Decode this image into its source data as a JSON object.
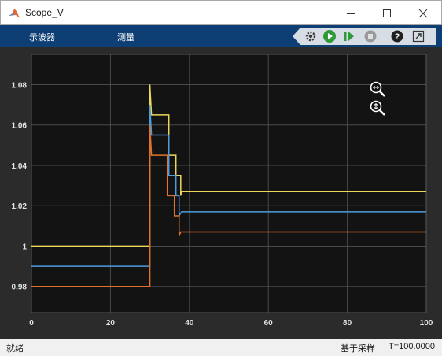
{
  "window": {
    "title": "Scope_V"
  },
  "toolbar": {
    "menu_view": "示波器",
    "menu_measure": "测量",
    "buttons": [
      {
        "icon": "gear-icon"
      },
      {
        "icon": "run-icon"
      },
      {
        "icon": "step-forward-icon"
      },
      {
        "icon": "stop-icon"
      },
      {
        "icon": "help-icon"
      },
      {
        "icon": "undock-icon"
      }
    ]
  },
  "status": {
    "state": "就绪",
    "mode": "基于采样",
    "time": "T=100.0000"
  },
  "colors": {
    "background": "#2b2b2b",
    "axes": "#131313",
    "grid": "#4a4a4a",
    "ticks": "#e6e6e6",
    "toolbar": "#0e3f74"
  },
  "chart_data": {
    "type": "line",
    "title": "",
    "xlabel": "",
    "ylabel": "",
    "xlim": [
      0,
      100
    ],
    "ylim": [
      0.967,
      1.095
    ],
    "xticks": [
      0,
      20,
      40,
      60,
      80,
      100
    ],
    "yticks": [
      0.98,
      1,
      1.02,
      1.04,
      1.06,
      1.08
    ],
    "ytick_labels": [
      "0.98",
      "1",
      "1.02",
      "1.04",
      "1.06",
      "1.08"
    ],
    "grid": true,
    "series": [
      {
        "color": "#edd75a",
        "points": [
          [
            0,
            1.0
          ],
          [
            30,
            1.0
          ],
          [
            30,
            1.08
          ],
          [
            30.4,
            1.065
          ],
          [
            34.8,
            1.065
          ],
          [
            34.8,
            1.045
          ],
          [
            36.6,
            1.045
          ],
          [
            36.6,
            1.035
          ],
          [
            37.8,
            1.035
          ],
          [
            37.8,
            1.025
          ],
          [
            38,
            1.027
          ],
          [
            100,
            1.027
          ]
        ]
      },
      {
        "color": "#4d9be0",
        "points": [
          [
            0,
            0.99
          ],
          [
            30,
            0.99
          ],
          [
            30,
            1.07
          ],
          [
            30.4,
            1.055
          ],
          [
            34.8,
            1.055
          ],
          [
            34.8,
            1.035
          ],
          [
            36.6,
            1.035
          ],
          [
            36.6,
            1.025
          ],
          [
            37.4,
            1.025
          ],
          [
            37.4,
            1.015
          ],
          [
            38,
            1.017
          ],
          [
            100,
            1.017
          ]
        ]
      },
      {
        "color": "#e2722a",
        "points": [
          [
            0,
            0.98
          ],
          [
            30,
            0.98
          ],
          [
            30,
            1.06
          ],
          [
            30.4,
            1.045
          ],
          [
            34.4,
            1.045
          ],
          [
            34.4,
            1.025
          ],
          [
            36.2,
            1.025
          ],
          [
            36.2,
            1.015
          ],
          [
            37.4,
            1.015
          ],
          [
            37.4,
            1.005
          ],
          [
            37.8,
            1.007
          ],
          [
            100,
            1.007
          ]
        ]
      }
    ]
  }
}
